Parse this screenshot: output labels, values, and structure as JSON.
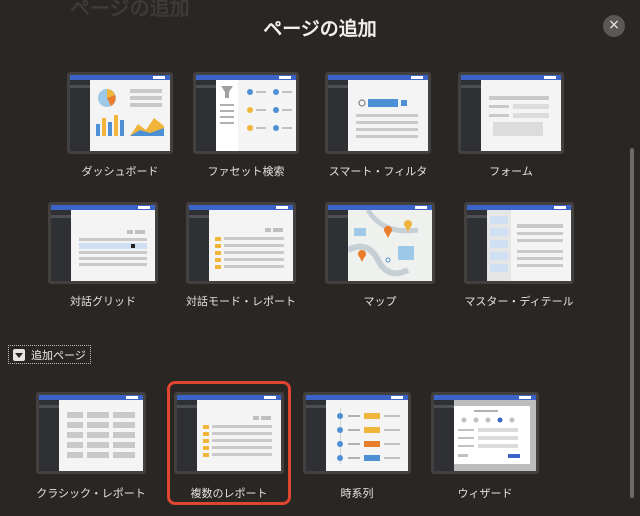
{
  "dialog": {
    "title": "ページの追加",
    "close_glyph": "×"
  },
  "pages": [
    {
      "label": "ダッシュボード"
    },
    {
      "label": "ファセット検索"
    },
    {
      "label": "スマート・フィルタ"
    },
    {
      "label": "フォーム"
    },
    {
      "label": "対話グリッド"
    },
    {
      "label": "対話モード・レポート"
    },
    {
      "label": "マップ"
    },
    {
      "label": "マスター・ディテール"
    }
  ],
  "additional_section": {
    "label": "追加ページ",
    "pages": [
      {
        "label": "クラシック・レポート"
      },
      {
        "label": "複数のレポート",
        "selected": true
      },
      {
        "label": "時系列"
      },
      {
        "label": "ウィザード"
      }
    ]
  },
  "colors": {
    "accent_bar": "#3c64c8",
    "selection_border": "#e0452f",
    "background": "#2a2624"
  }
}
